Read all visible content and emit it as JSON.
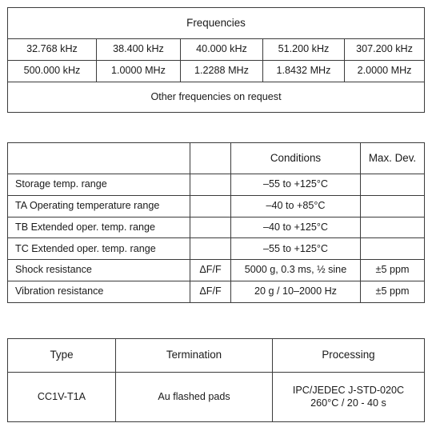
{
  "tables": {
    "frequencies": {
      "title": "Frequencies",
      "rows": [
        [
          "32.768 kHz",
          "38.400 kHz",
          "40.000 kHz",
          "51.200 kHz",
          "307.200 kHz"
        ],
        [
          "500.000 kHz",
          "1.0000 MHz",
          "1.2288 MHz",
          "1.8432 MHz",
          "2.0000 MHz"
        ]
      ],
      "footnote": "Other frequencies on request"
    },
    "environment": {
      "headers": [
        "",
        "",
        "Conditions",
        "Max. Dev."
      ],
      "rows": [
        {
          "parameter": "Storage temp. range",
          "symbol": "",
          "conditions": "–55 to +125°C",
          "max_dev": ""
        },
        {
          "parameter": "TA Operating temperature range",
          "symbol": "",
          "conditions": "–40 to +85°C",
          "max_dev": ""
        },
        {
          "parameter": "TB Extended oper. temp. range",
          "symbol": "",
          "conditions": "–40 to +125°C",
          "max_dev": ""
        },
        {
          "parameter": "TC Extended oper. temp. range",
          "symbol": "",
          "conditions": "–55 to +125°C",
          "max_dev": ""
        },
        {
          "parameter": "Shock resistance",
          "symbol": "ΔF/F",
          "conditions": "5000 g, 0.3 ms, ½ sine",
          "max_dev": "±5 ppm"
        },
        {
          "parameter": "Vibration resistance",
          "symbol": "ΔF/F",
          "conditions": "20 g / 10–2000 Hz",
          "max_dev": "±5 ppm"
        }
      ]
    },
    "packaging": {
      "headers": [
        "Type",
        "Termination",
        "Processing"
      ],
      "row": {
        "type": "CC1V-T1A",
        "termination": "Au flashed pads",
        "processing": "IPC/JEDEC J-STD-020C\n260°C / 20 - 40 s"
      }
    }
  },
  "colors": {
    "border": "#3b3b3b",
    "text": "#1a1a1a",
    "background": "#ffffff"
  }
}
